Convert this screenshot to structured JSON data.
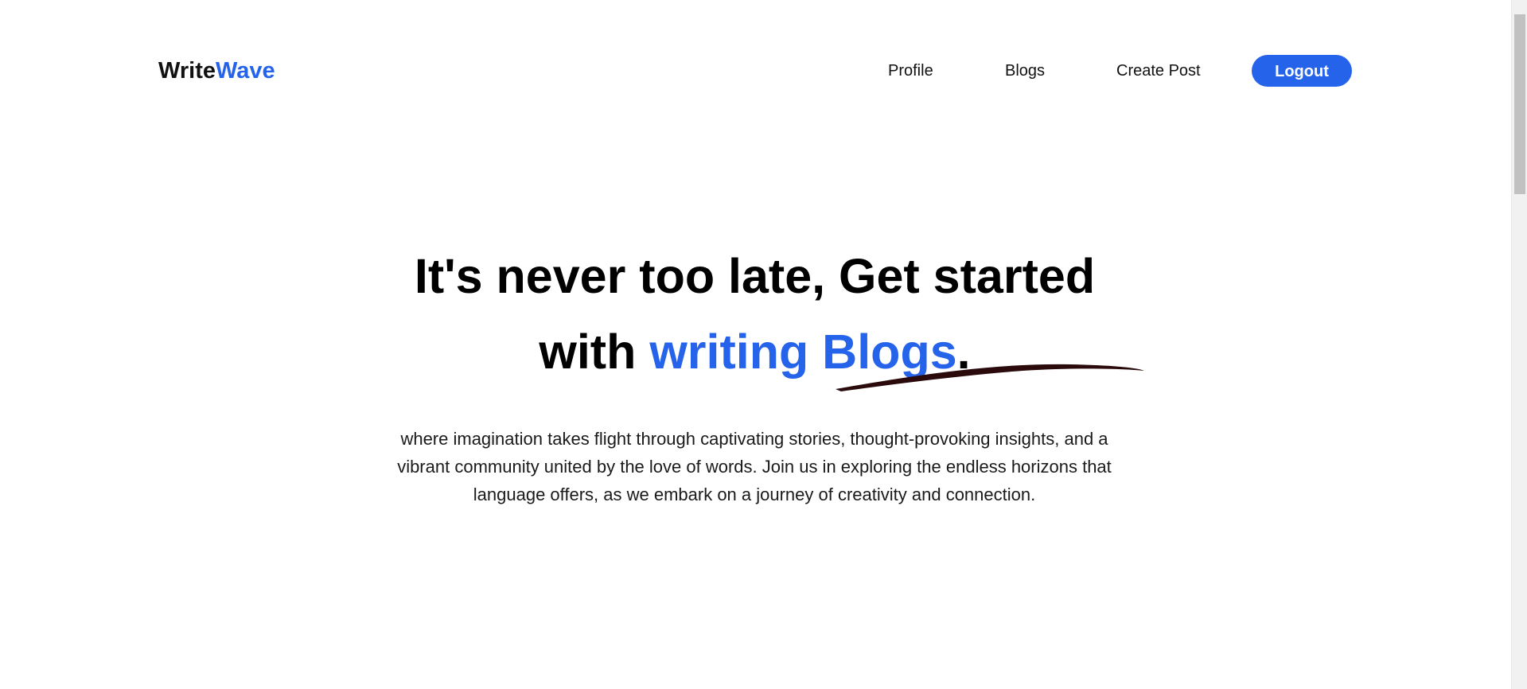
{
  "header": {
    "logo_part1": "Write",
    "logo_part2": "Wave",
    "nav": {
      "profile": "Profile",
      "blogs": "Blogs",
      "create_post": "Create Post"
    },
    "logout_label": "Logout"
  },
  "hero": {
    "title_line1": "It's never too late, Get started",
    "title_with": "with ",
    "title_highlight": "writing Blogs",
    "title_period": ".",
    "description": "where imagination takes flight through captivating stories, thought-provoking insights, and a vibrant community united by the love of words. Join us in exploring the endless horizons that language offers, as we embark on a journey of creativity and connection."
  },
  "colors": {
    "accent": "#2563eb",
    "text": "#111111",
    "swoosh": "#2a0a0a"
  },
  "icons": {
    "underline": "brush-underline-icon"
  }
}
